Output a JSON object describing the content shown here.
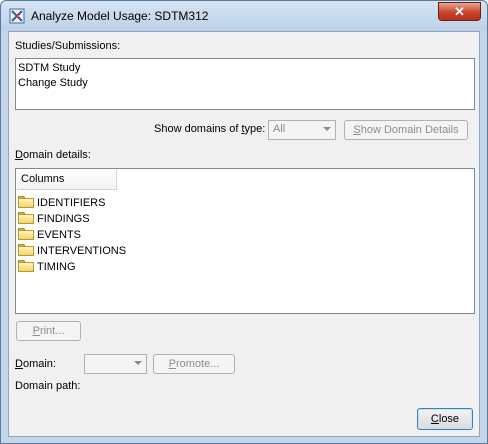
{
  "window": {
    "title": "Analyze Model Usage:  SDTM312",
    "close_glyph": "✕"
  },
  "studies": {
    "label": "Studies/Submissions:",
    "items": [
      "SDTM Study",
      "Change Study"
    ]
  },
  "filter": {
    "label_prefix": "Show domains of ",
    "label_ul": "t",
    "label_suffix": "ype:",
    "value": "All",
    "details_btn_ul": "S",
    "details_btn_rest": "how Domain Details"
  },
  "domain_details": {
    "label_ul": "D",
    "label_rest": "omain details:",
    "column_header": "Columns",
    "folders": [
      "IDENTIFIERS",
      "FINDINGS",
      "EVENTS",
      "INTERVENTIONS",
      "TIMING"
    ]
  },
  "print_btn": {
    "ul": "P",
    "rest": "rint..."
  },
  "domain": {
    "label_ul": "D",
    "label_rest": "omain:",
    "value": "",
    "promote_ul": "P",
    "promote_rest": "romote...",
    "path_label": "Domain path:"
  },
  "close_btn": {
    "ul": "C",
    "rest": "lose"
  },
  "colors": {
    "title_bar": "#c4d6ea",
    "close_x": "#c7442a",
    "folder": "#f2d663"
  }
}
